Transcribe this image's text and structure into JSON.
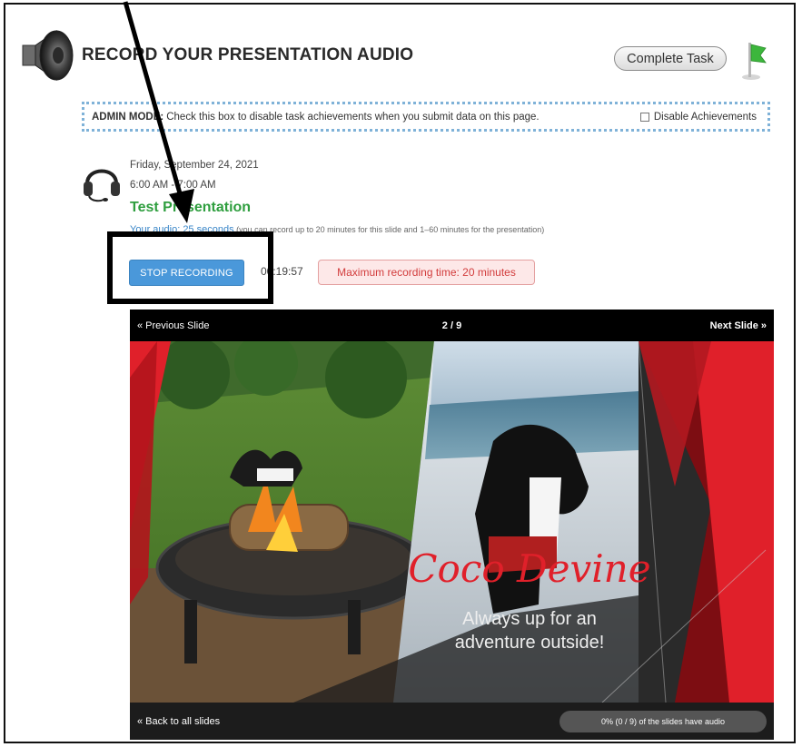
{
  "header": {
    "title": "RECORD YOUR PRESENTATION AUDIO",
    "complete_button": "Complete Task"
  },
  "admin_mode": {
    "label": "ADMIN MODE:",
    "description": "Check this box to disable task achievements when you submit data on this page.",
    "checkbox_label": "Disable Achievements"
  },
  "presentation": {
    "date": "Friday, September 24, 2021",
    "time": "6:00 AM - 7:00 AM",
    "title": "Test Presentation",
    "audio_prefix": "Your audio: ",
    "audio_duration": "25 seconds",
    "audio_suffix": " (you can record up to 20 minutes for this slide and 1–60 minutes for the presentation)"
  },
  "recording": {
    "stop_button": "STOP RECORDING",
    "timer": "00:19:57",
    "max_badge": "Maximum recording time: 20 minutes"
  },
  "viewer": {
    "prev_label": "« Previous Slide",
    "counter": "2 / 9",
    "next_label": "Next Slide »",
    "back_label": "« Back to all slides",
    "progress_text": "0% (0 / 9) of the slides have audio",
    "slide_title": "Coco Devine",
    "slide_caption_line1": "Always up for an",
    "slide_caption_line2": "adventure outside!"
  },
  "colors": {
    "accent_blue": "#4a98da",
    "title_green": "#2e9e3e",
    "alert_red": "#d23c3c",
    "slide_red": "#e0202a"
  }
}
